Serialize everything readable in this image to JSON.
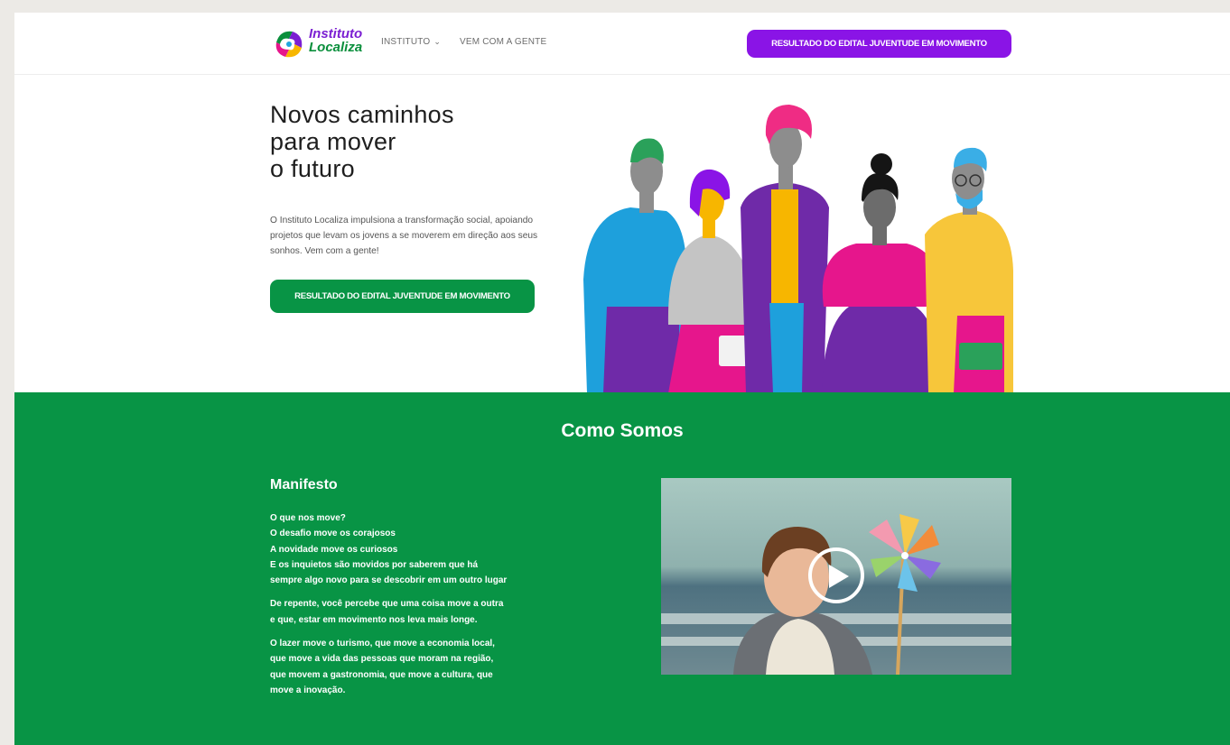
{
  "header": {
    "logo": {
      "line1": "Instituto",
      "line2": "Localiza"
    },
    "nav": [
      {
        "label": "INSTITUTO",
        "icon": "chevron-down-icon"
      },
      {
        "label": "VEM COM A GENTE"
      }
    ],
    "cta_label": "RESULTADO DO EDITAL JUVENTUDE EM MOVIMENTO"
  },
  "hero": {
    "title": "Novos caminhos\npara mover\no futuro",
    "description": "O Instituto Localiza impulsiona a transformação social, apoiando projetos que levam os jovens a se moverem em direção aos seus sonhos. Vem com a gente!",
    "cta_label": "RESULTADO DO EDITAL JUVENTUDE EM MOVIMENTO"
  },
  "como_somos": {
    "title": "Como Somos",
    "manifesto_title": "Manifesto",
    "paragraphs": [
      [
        "O que nos move?",
        "O desafio move os corajosos",
        "A novidade move os curiosos",
        "E os inquietos são movidos por saberem que há",
        "sempre algo novo para se descobrir em um outro lugar"
      ],
      [
        "De repente, você percebe que uma coisa move a outra",
        "e que, estar em movimento nos leva mais longe."
      ],
      [
        "O lazer move o turismo, que move a economia local,",
        "que move a vida das pessoas que moram na região,",
        "que movem a gastronomia, que move a cultura, que",
        "move a inovação."
      ]
    ],
    "video_icon": "play-icon"
  },
  "colors": {
    "brand_purple": "#8a14e6",
    "brand_green": "#089445"
  }
}
